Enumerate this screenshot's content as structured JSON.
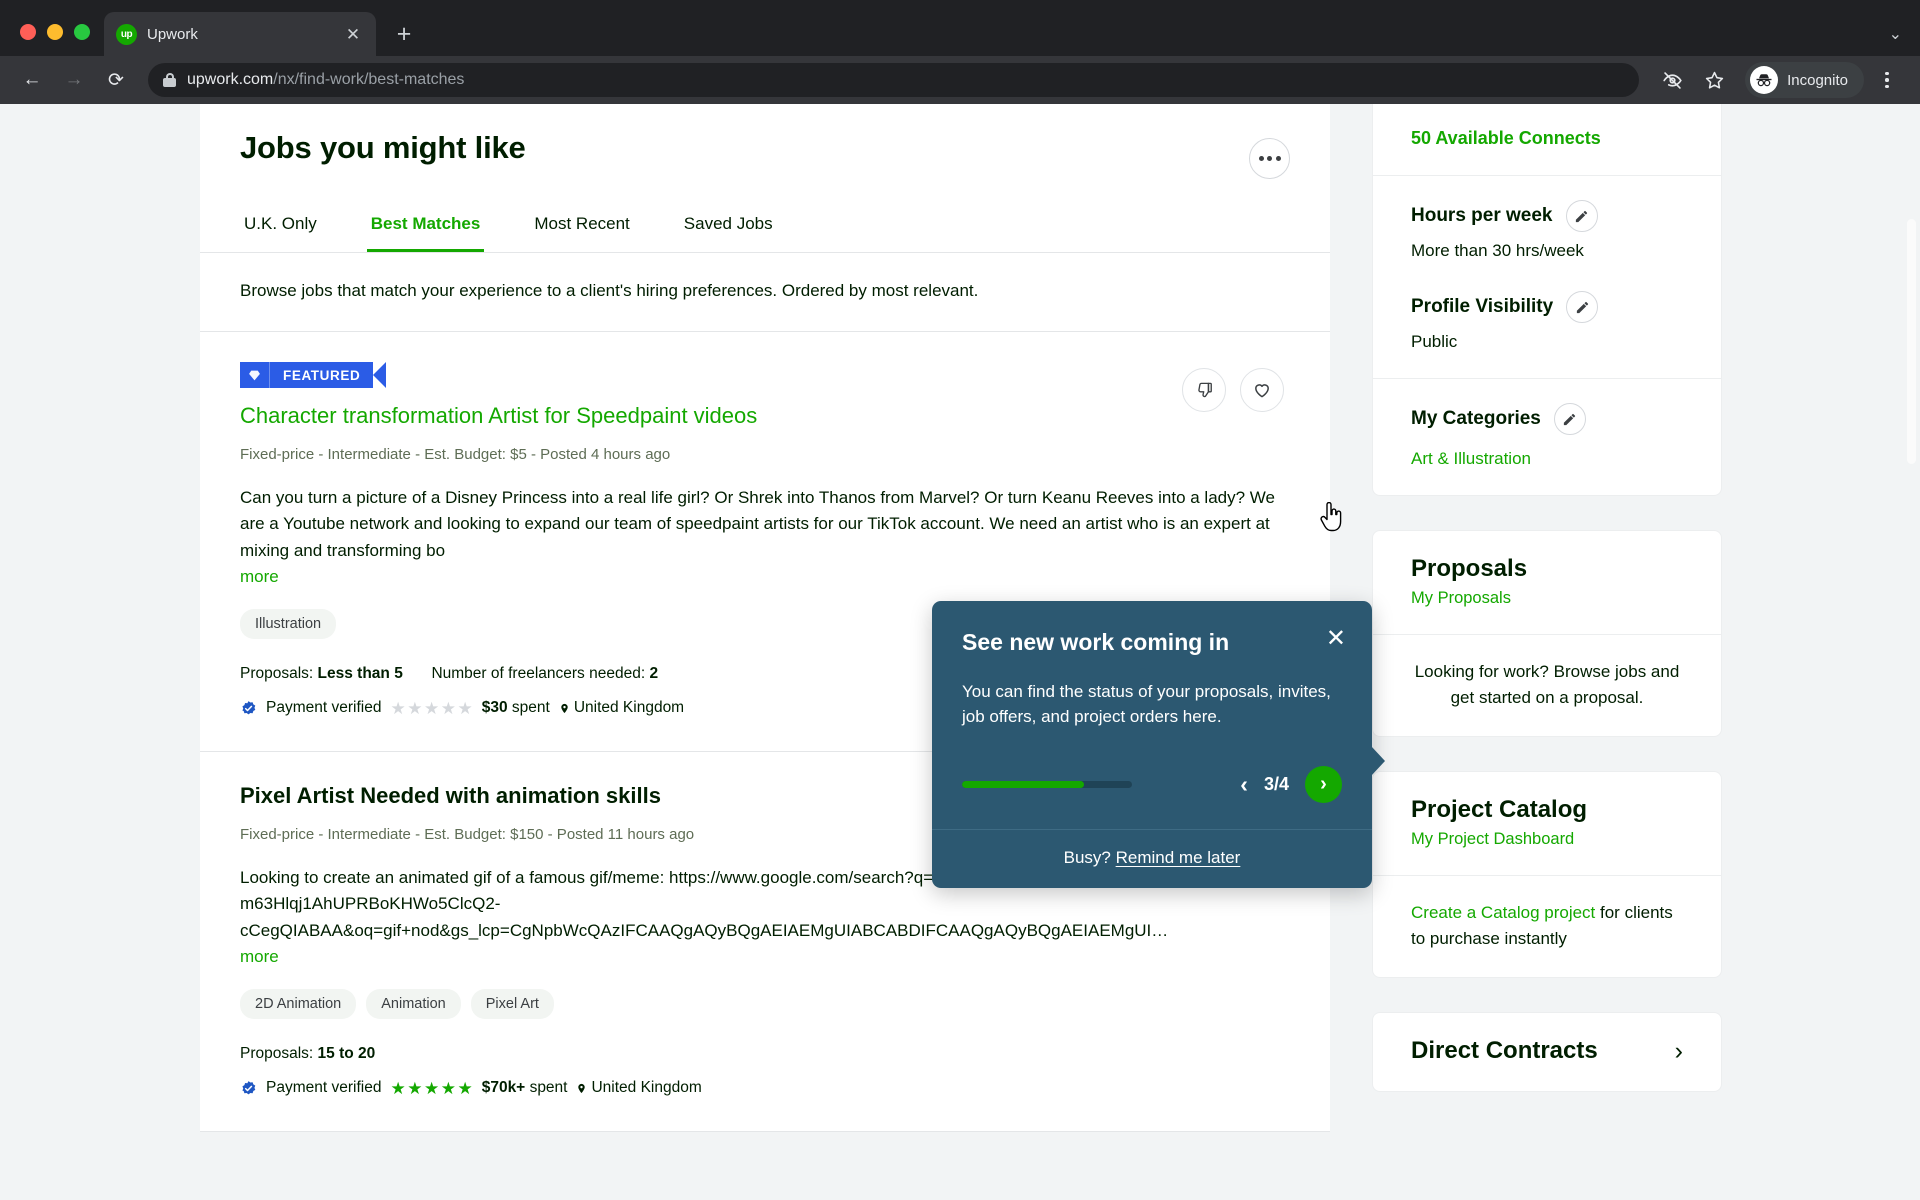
{
  "browser": {
    "tab": {
      "title": "Upwork",
      "favicon_label": "up",
      "close_icon": "close-icon"
    },
    "new_tab_label": "+",
    "tabstrip_chevron": "⌄",
    "back_label": "←",
    "forward_label": "→",
    "reload_label": "⟳",
    "url_domain": "upwork.com",
    "url_path": "/nx/find-work/best-matches",
    "incognito_label": "Incognito"
  },
  "main": {
    "title": "Jobs you might like",
    "tabs": [
      {
        "label": "U.K. Only",
        "active": false
      },
      {
        "label": "Best Matches",
        "active": true
      },
      {
        "label": "Most Recent",
        "active": false
      },
      {
        "label": "Saved Jobs",
        "active": false
      }
    ],
    "blurb": "Browse jobs that match your experience to a client's hiring preferences. Ordered by most relevant.",
    "jobs": [
      {
        "featured_label": "FEATURED",
        "title": "Character transformation Artist for Speedpaint videos",
        "meta": "Fixed-price - Intermediate - Est. Budget: $5 - Posted 4 hours ago",
        "description": "Can you turn a picture of a Disney Princess into a real life girl? Or Shrek into Thanos from Marvel? Or turn Keanu Reeves into a lady? We are a Youtube network and looking to expand our team of speedpaint artists for our TikTok account. We need an artist who is an expert at mixing and transforming bo",
        "more_label": "more",
        "tags": [
          "Illustration"
        ],
        "proposals_label": "Proposals:",
        "proposals_value": "Less than 5",
        "freelancers_label": "Number of freelancers needed:",
        "freelancers_value": "2",
        "payment_verified": "Payment verified",
        "rating": 0,
        "spent_amount": "$30",
        "spent_label": "spent",
        "location": "United Kingdom"
      },
      {
        "title": "Pixel Artist Needed with animation skills",
        "meta": "Fixed-price - Intermediate - Est. Budget: $150 - Posted 11 hours ago",
        "description": "Looking to create an animated gif of a famous gif/meme: https://www.google.com/search?q=gif+nod&tbm=isch&ved=2ahUKEwj-m63Hlqj1AhUPRBoKHWo5ClcQ2-cCegQIABAA&oq=gif+nod&gs_lcp=CgNpbWcQAzIFCAAQgAQyBQgAEIAEMgUIABCABDIFCAAQgAQyBQgAEIAEMgUI…",
        "more_label": "more",
        "tags": [
          "2D Animation",
          "Animation",
          "Pixel Art"
        ],
        "proposals_label": "Proposals:",
        "proposals_value": "15 to 20",
        "payment_verified": "Payment verified",
        "rating": 5,
        "spent_amount": "$70k+",
        "spent_label": "spent",
        "location": "United Kingdom"
      }
    ]
  },
  "sidebar": {
    "connects": "50 Available Connects",
    "settings": [
      {
        "label": "Hours per week",
        "value": "More than 30 hrs/week",
        "edit_icon": "pencil-icon"
      },
      {
        "label": "Profile Visibility",
        "value": "Public",
        "edit_icon": "pencil-icon"
      }
    ],
    "categories": {
      "label": "My Categories",
      "edit_icon": "pencil-icon",
      "value": "Art & Illustration"
    },
    "proposals": {
      "title": "Proposals",
      "link": "My Proposals",
      "body": "Looking for work? Browse jobs and get started on a proposal."
    },
    "catalog": {
      "title": "Project Catalog",
      "link": "My Project Dashboard",
      "body_link": "Create a Catalog project",
      "body_rest": " for clients to purchase instantly"
    },
    "direct_contracts": {
      "title": "Direct Contracts",
      "chevron": "›"
    }
  },
  "tooltip": {
    "title": "See new work coming in",
    "close_icon": "close-icon",
    "text": "You can find the status of your proposals, invites, job offers, and project orders here.",
    "progress_percent": 72,
    "prev_label": "‹",
    "counter": "3/4",
    "next_label": "›",
    "footer_prefix": "Busy? ",
    "footer_link": "Remind me later"
  },
  "colors": {
    "accent_green": "#14a800",
    "featured_blue": "#2b5ce6",
    "tooltip_bg": "#2c5871",
    "verified_blue": "#1f57c3"
  }
}
